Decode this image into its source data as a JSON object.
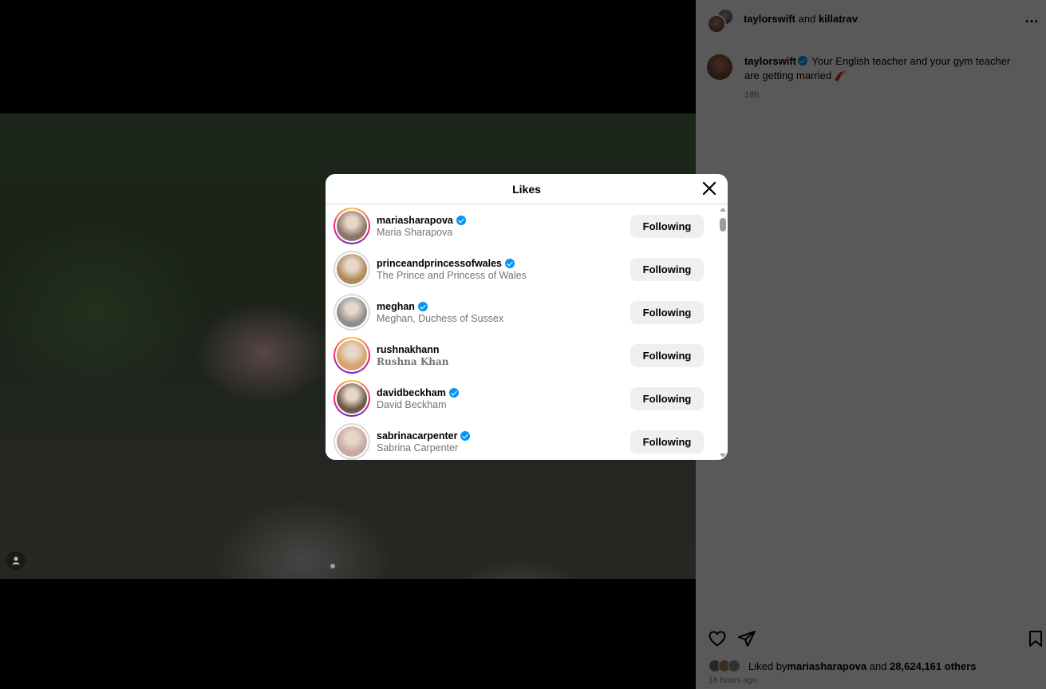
{
  "post": {
    "header_user1": "taylorswift",
    "header_and": " and ",
    "header_user2": "killatrav",
    "more_icon": "…",
    "caption_user": "taylorswift",
    "caption_text": " Your English teacher and your gym teacher are getting married ",
    "caption_emoji": "🧨",
    "caption_time": "18h",
    "liked_by_prefix": "Liked by ",
    "liked_by_user": "mariasharapova",
    "liked_by_middle": " and ",
    "liked_by_count": "28,624,161 others",
    "post_time": "18 hours ago"
  },
  "modal": {
    "title": "Likes",
    "likes": [
      {
        "username": "mariasharapova",
        "fullname": "Maria Sharapova",
        "verified": true,
        "button": "Following",
        "story": true,
        "color": "#8a7566"
      },
      {
        "username": "princeandprincessofwales",
        "fullname": "The Prince and Princess of Wales",
        "verified": true,
        "button": "Following",
        "story": false,
        "color": "#b08a5c"
      },
      {
        "username": "meghan",
        "fullname": "Meghan, Duchess of Sussex",
        "verified": true,
        "button": "Following",
        "story": false,
        "color": "#8e8e8e"
      },
      {
        "username": "rushnakhann",
        "fullname": "Rushna Khan",
        "verified": false,
        "button": "Following",
        "story": true,
        "color": "#d7a36a"
      },
      {
        "username": "davidbeckham",
        "fullname": "David Beckham",
        "verified": true,
        "button": "Following",
        "story": true,
        "color": "#6e5a48"
      },
      {
        "username": "sabrinacarpenter",
        "fullname": "Sabrina Carpenter",
        "verified": true,
        "button": "Following",
        "story": false,
        "color": "#c9a7a2"
      }
    ]
  },
  "colors": {
    "verified_blue": "#0095f6",
    "button_bg": "#efefef",
    "secondary_text": "#737373"
  },
  "icons": {
    "close": "close-icon",
    "like": "heart-icon",
    "share": "paper-plane-icon",
    "save": "bookmark-icon",
    "user_tag": "user-icon"
  }
}
